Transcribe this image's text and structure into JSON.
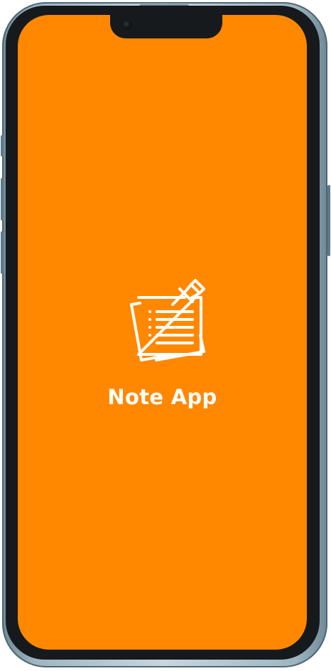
{
  "splash": {
    "title": "Note App",
    "logo_icon": "pinned-notes-icon",
    "background_color": "#ff8800",
    "foreground_color": "#ffffff"
  },
  "device": {
    "frame_color": "#9fb6c2",
    "bezel_color": "#161a1c"
  }
}
